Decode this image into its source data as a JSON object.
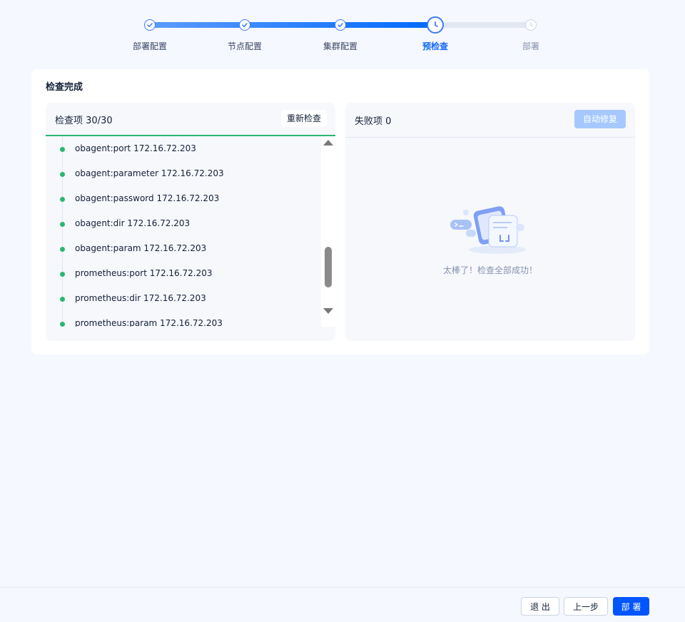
{
  "stepper": {
    "steps": [
      {
        "label": "部署配置",
        "status": "done"
      },
      {
        "label": "节点配置",
        "status": "done"
      },
      {
        "label": "集群配置",
        "status": "done"
      },
      {
        "label": "预检查",
        "status": "active"
      },
      {
        "label": "部署",
        "status": "wait"
      }
    ]
  },
  "card": {
    "title": "检查完成"
  },
  "check_panel": {
    "title": "检查项 30/30",
    "recheck_label": "重新检查",
    "items": [
      "obagent:port 172.16.72.203",
      "obagent:parameter 172.16.72.203",
      "obagent:password 172.16.72.203",
      "obagent:dir 172.16.72.203",
      "obagent:param 172.16.72.203",
      "prometheus:port 172.16.72.203",
      "prometheus:dir 172.16.72.203",
      "prometheus:param 172.16.72.203"
    ]
  },
  "fail_panel": {
    "title": "失败项 0",
    "autofix_label": "自动修复",
    "empty_text": "太棒了！检查全部成功！"
  },
  "footer": {
    "exit_label": "退 出",
    "prev_label": "上一步",
    "deploy_label": "部 署"
  },
  "colors": {
    "accent": "#006aff",
    "success": "#2ab673",
    "disabled_button": "#a6c8ff"
  }
}
